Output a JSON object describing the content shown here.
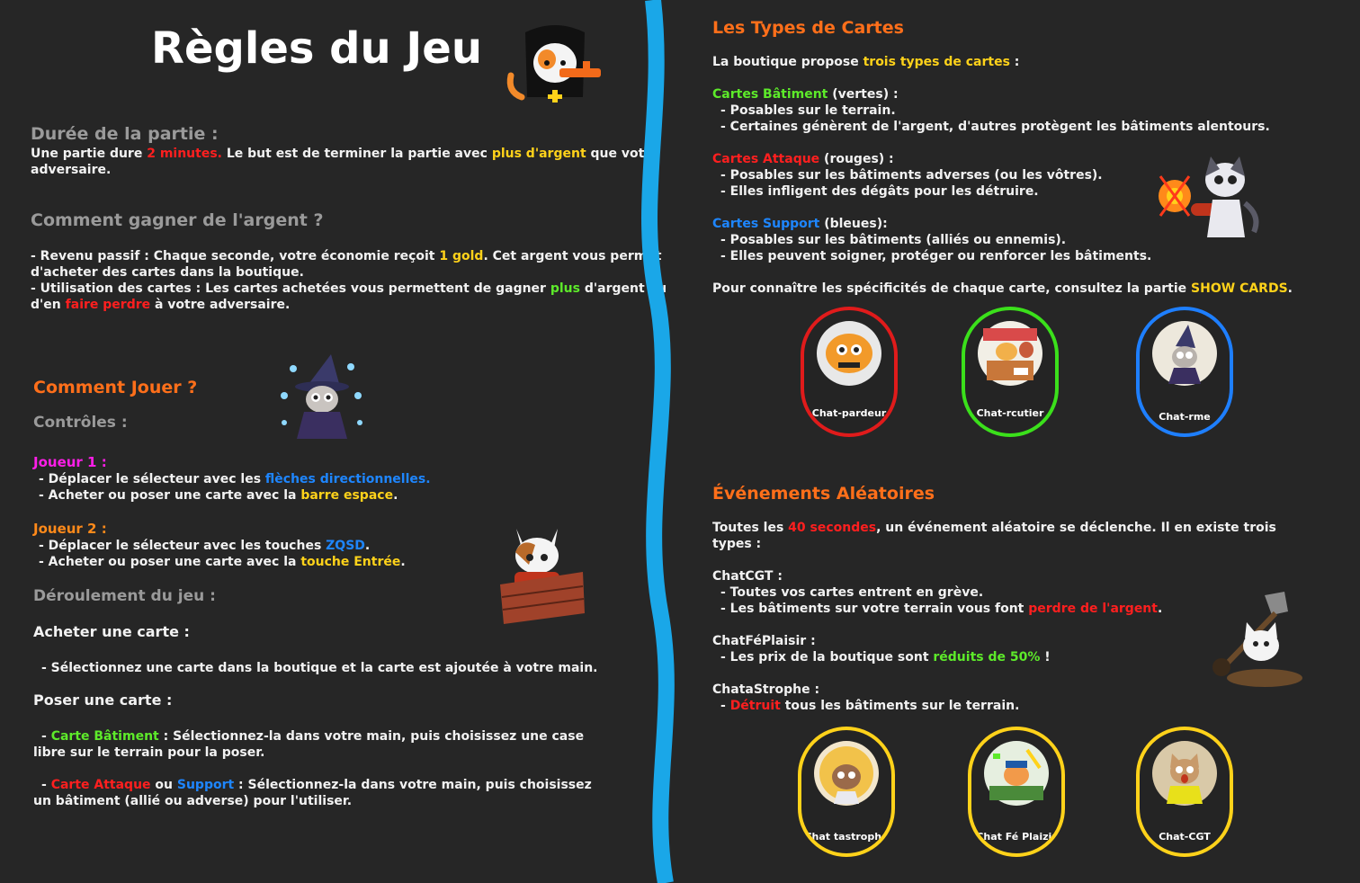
{
  "title": "Règles du Jeu",
  "left": {
    "duree_heading": "Durée de la partie :",
    "duree_l1_a": "Une partie dure ",
    "duree_l1_b": "2 minutes.",
    "duree_l1_c": " Le but est de terminer la partie avec ",
    "duree_l1_d": "plus d'argent",
    "duree_l1_e": " que votre",
    "duree_l2": "adversaire.",
    "gagner_heading": "Comment gagner de l'argent ?",
    "g1_a": "- Revenu passif : Chaque seconde, votre économie reçoit ",
    "g1_b": "1 gold",
    "g1_c": ". Cet argent vous permet",
    "g2": "d'acheter des cartes dans la boutique.",
    "g3_a": "- Utilisation des cartes :  Les cartes achetées vous permettent de gagner ",
    "g3_b": "plus",
    "g3_c": " d'argent ou",
    "g4_a": "d'en ",
    "g4_b": "faire perdre",
    "g4_c": "  à votre adversaire.",
    "jouer_heading": "Comment Jouer ?",
    "controles": "Contrôles :",
    "j1_heading": "Joueur 1 :",
    "j1_l1_a": "- Déplacer le sélecteur avec les ",
    "j1_l1_b": "flèches directionnelles.",
    "j1_l2_a": "- Acheter ou poser une carte avec la ",
    "j1_l2_b": "barre espace",
    "j1_l2_c": ".",
    "j2_heading": "Joueur 2 :",
    "j2_l1_a": "- Déplacer le sélecteur avec les touches ",
    "j2_l1_b": "ZQSD",
    "j2_l1_c": ".",
    "j2_l2_a": "- Acheter ou poser une carte avec la ",
    "j2_l2_b": "touche Entrée",
    "j2_l2_c": ".",
    "deroulement": "Déroulement du jeu :",
    "acheter_heading": "Acheter une carte :",
    "acheter_l1": "- Sélectionnez une carte dans la boutique et la carte est ajoutée à votre main.",
    "poser_heading": "Poser une carte :",
    "poser_l1_a": "- ",
    "poser_l1_b": "Carte Bâtiment",
    "poser_l1_c": " : Sélectionnez-la dans votre main, puis choisissez une case",
    "poser_l2": "libre sur le terrain pour la poser.",
    "poser_l3_a": "- ",
    "poser_l3_b": "Carte Attaque",
    "poser_l3_c": "  ou ",
    "poser_l3_d": "Support",
    "poser_l3_e": " : Sélectionnez-la dans votre main, puis choisissez",
    "poser_l4": "un bâtiment (allié ou adverse) pour l'utiliser."
  },
  "right": {
    "types_heading": "Les Types de Cartes",
    "intro_a": "La boutique propose ",
    "intro_b": "trois types de cartes",
    "intro_c": " :",
    "bat_a": "Cartes Bâtiment",
    "bat_b": " (vertes) :",
    "bat_l1": "- Posables sur le terrain.",
    "bat_l2": "- Certaines génèrent de l'argent, d'autres protègent les bâtiments alentours.",
    "att_a": "Cartes Attaque",
    "att_b": " (rouges) :",
    "att_l1": "- Posables sur les bâtiments adverses (ou les vôtres).",
    "att_l2": "- Elles infligent des dégâts pour les détruire.",
    "sup_a": "Cartes Support",
    "sup_b": " (bleues):",
    "sup_l1": "- Posables sur les bâtiments (alliés ou ennemis).",
    "sup_l2": "- Elles peuvent soigner, protéger ou renforcer les bâtiments.",
    "show_a": "Pour connaître les spécificités de chaque carte, consultez la partie ",
    "show_b": "SHOW CARDS",
    "show_c": ".",
    "cards": [
      {
        "label": "Chat-pardeur",
        "color": "#e01b1b"
      },
      {
        "label": "Chat-rcutier",
        "color": "#3be01b"
      },
      {
        "label": "Chat-rme",
        "color": "#1e7fff"
      }
    ],
    "events_heading": "Événements Aléatoires",
    "ev_a": "Toutes les ",
    "ev_b": "40 secondes",
    "ev_c": ", un événement aléatoire se déclenche. Il en existe trois",
    "ev_l2": "types :",
    "cgt_heading": "ChatCGT :",
    "cgt_l1": "- Toutes vos cartes entrent en grève.",
    "cgt_l2_a": "- Les bâtiments sur votre terrain vous font ",
    "cgt_l2_b": "perdre de l'argent",
    "cgt_l2_c": ".",
    "fp_heading": "ChatFéPlaisir :",
    "fp_l1_a": "- Les prix de la boutique sont ",
    "fp_l1_b": "réduits de 50%",
    "fp_l1_c": " !",
    "cata_heading": "ChataStrophe :",
    "cata_l1_a": "- ",
    "cata_l1_b": "Détruit",
    "cata_l1_c": " tous les bâtiments sur le terrain.",
    "event_cards": [
      {
        "label": "Chat tastrophe",
        "color": "#ffd21a"
      },
      {
        "label": "Chat Fé Plaizir",
        "color": "#ffd21a"
      },
      {
        "label": "Chat-CGT",
        "color": "#ffd21a"
      }
    ]
  },
  "colors": {
    "divider": "#1aa7e8",
    "background": "#262626"
  }
}
